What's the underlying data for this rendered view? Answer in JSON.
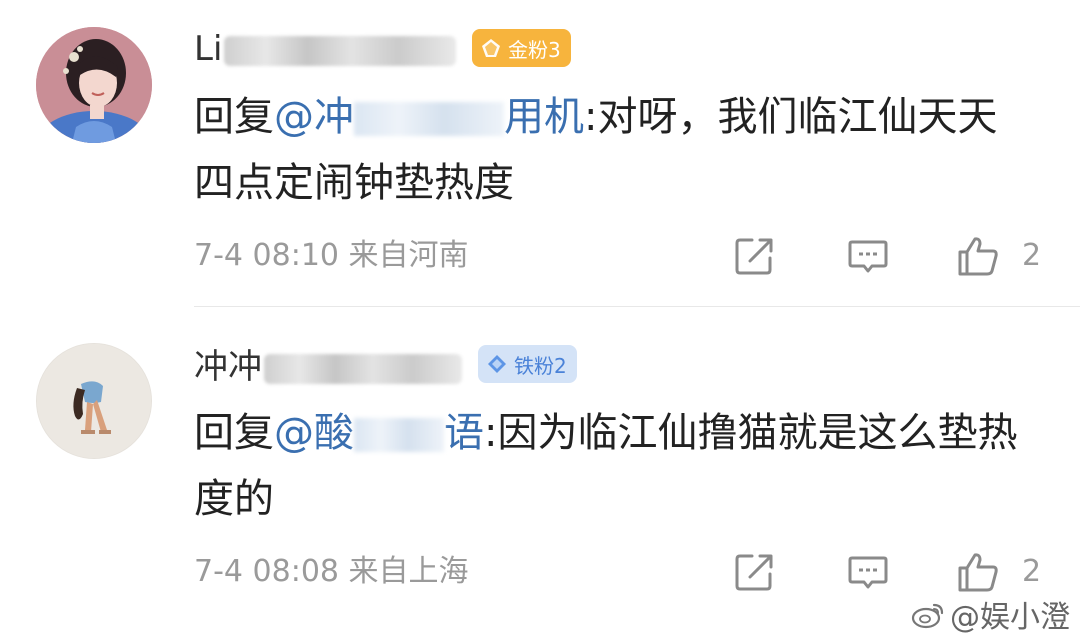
{
  "colors": {
    "mention": "#3a6fb0",
    "meta_text": "#9a9a9a",
    "gold_badge": "#f7b43d",
    "iron_badge_bg": "#d4e3f7",
    "iron_badge_text": "#4a82d8"
  },
  "comments": [
    {
      "username_visible": "Li",
      "badge": {
        "label": "金粉3",
        "icon": "gold-gem-icon"
      },
      "body": {
        "prefix": "回复",
        "mention_start": "@冲",
        "mention_end": "用机",
        "text": ":对呀，我们临江仙天天四点定闹钟垫热度"
      },
      "meta": {
        "time": "7-4 08:10",
        "location": "来自河南"
      },
      "actions": {
        "share_icon": "share-icon",
        "comment_icon": "comment-icon",
        "like_icon": "thumbs-up-icon",
        "like_count": "2"
      }
    },
    {
      "username_visible": "冲冲",
      "badge": {
        "label": "铁粉2",
        "icon": "diamond-icon"
      },
      "body": {
        "prefix": "回复",
        "mention_start": "@酸",
        "mention_end": "语",
        "text": ":因为临江仙撸猫就是这么垫热度的"
      },
      "meta": {
        "time": "7-4 08:08",
        "location": "来自上海"
      },
      "actions": {
        "share_icon": "share-icon",
        "comment_icon": "comment-icon",
        "like_icon": "thumbs-up-icon",
        "like_count": "2"
      }
    }
  ],
  "watermark": {
    "text": "@娱小澄",
    "icon": "weibo-icon"
  }
}
